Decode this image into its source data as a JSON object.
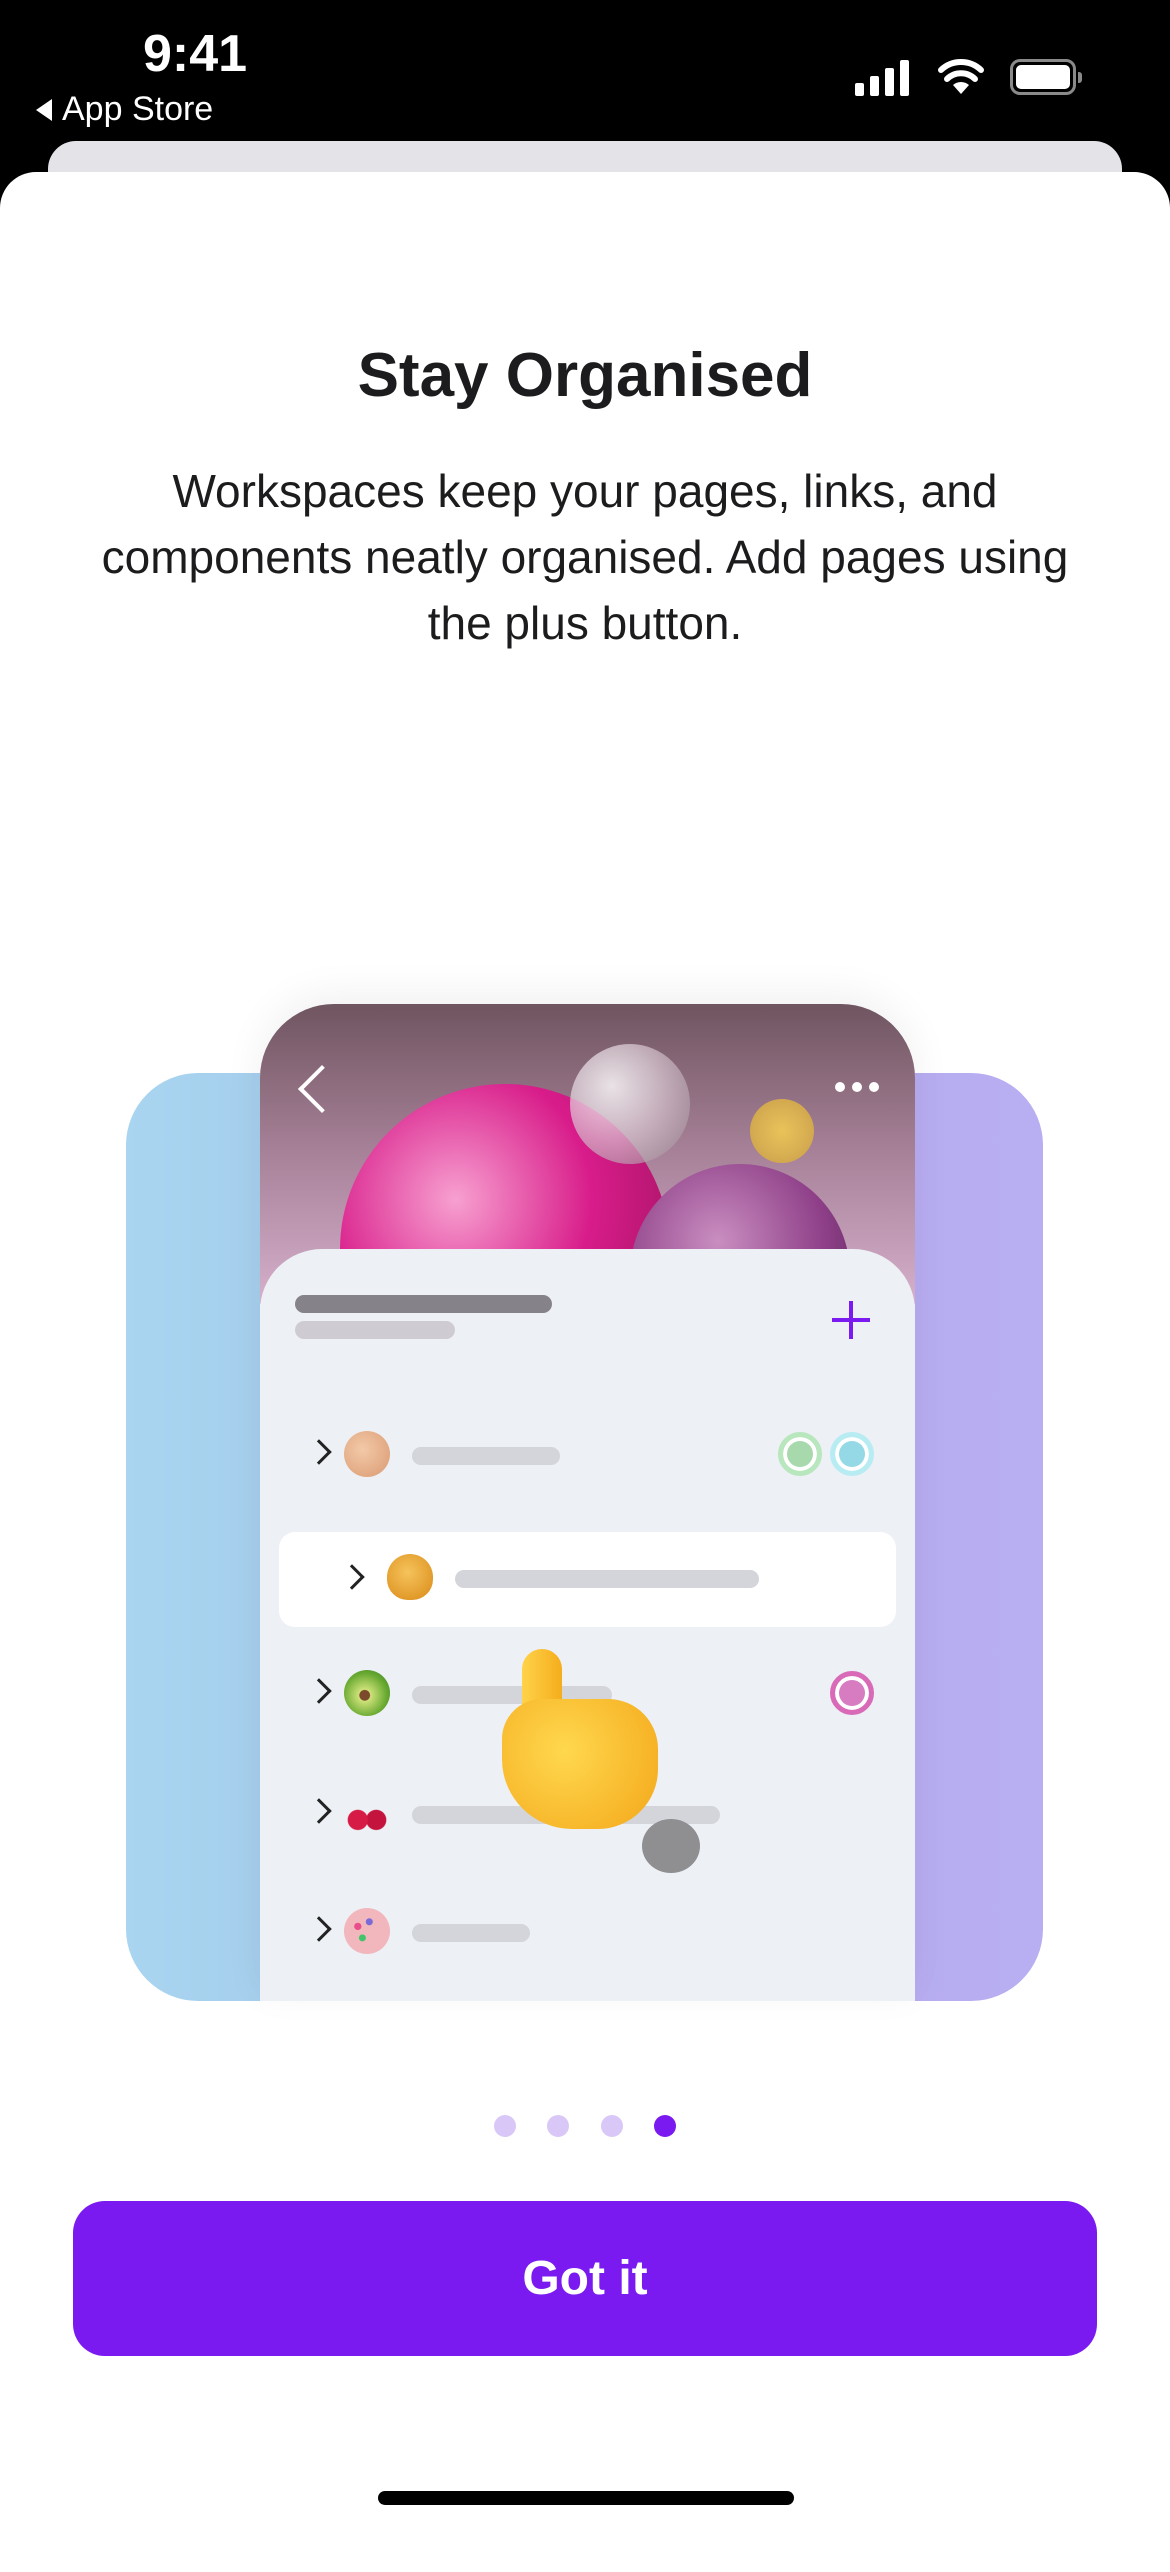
{
  "status_bar": {
    "time": "9:41",
    "back_label": "App Store",
    "icons": [
      "cellular-signal-icon",
      "wifi-icon",
      "battery-icon"
    ]
  },
  "onboarding": {
    "title": "Stay Organised",
    "description": "Workspaces keep your pages, links, and components neatly organised. Add pages using the plus button.",
    "illustration": {
      "rows": [
        {
          "icon": "cookie-icon",
          "tags": [
            "#9fd9a5",
            "#8ad7e6"
          ]
        },
        {
          "icon": "money-bag-icon",
          "highlighted": true
        },
        {
          "icon": "avocado-icon",
          "tags": [
            "#d65fb0"
          ]
        },
        {
          "icon": "cherries-icon"
        },
        {
          "icon": "artist-palette-icon"
        }
      ],
      "plus_color": "#7a1af0"
    },
    "pagination": {
      "total": 4,
      "current": 4
    },
    "button_label": "Got it"
  },
  "colors": {
    "accent": "#7a1af0",
    "dot_inactive": "#d9c8f7"
  }
}
